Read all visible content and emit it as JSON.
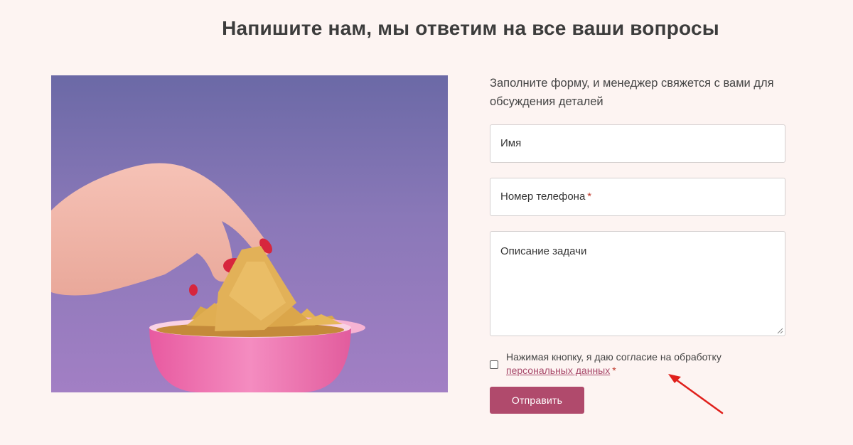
{
  "page": {
    "title": "Напишите нам, мы ответим на все ваши вопросы"
  },
  "form": {
    "intro": "Заполните форму, и менеджер свяжется с вами для обсуждения деталей",
    "name_placeholder": "Имя",
    "phone_placeholder": "Номер телефона",
    "task_placeholder": "Описание задачи",
    "required_mark": "*",
    "consent_text": "Нажимая кнопку, я даю согласие на обработку",
    "consent_link": "персональных данных",
    "consent_checked": false,
    "submit_label": "Отправить"
  },
  "colors": {
    "background": "#fdf4f2",
    "accent": "#b04a6c",
    "required": "#c0392b",
    "annotation_arrow": "#e0201c"
  },
  "icons": {
    "annotation": "red-arrow-icon",
    "textarea_resize": "resize-grip-icon"
  }
}
